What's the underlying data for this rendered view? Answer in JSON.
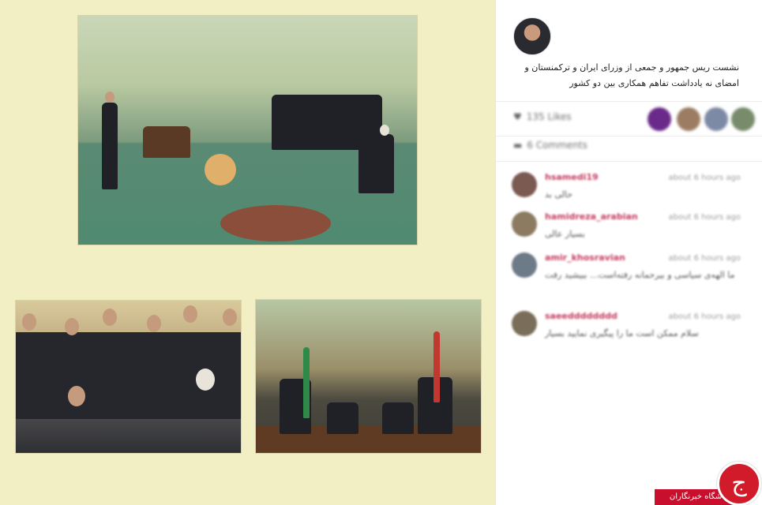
{
  "post": {
    "caption": "نشست ریس جمهور و جمعی از وزرای ایران و ترکمنستان و امضای نه یادداشت تفاهم همکاری بین دو کشور",
    "likes_label": "135 Likes",
    "comments_label": "6 Comments",
    "like_icon": "heart-icon",
    "comment_icon": "comment-icon"
  },
  "photos": [
    {
      "caption": ""
    },
    {
      "caption": ""
    },
    {
      "caption": ""
    }
  ],
  "comments": [
    {
      "user": "hsamedi19",
      "time": "about 6 hours ago",
      "text": "حالی بد"
    },
    {
      "user": "hamidreza_arabian",
      "time": "about 6 hours ago",
      "text": "بسیار عالی"
    },
    {
      "user": "amir_khosravian",
      "time": "about 6 hours ago",
      "text": "ما الهه‌ی سیاسی و بیرحمانه رفته‌است... ببیشید رفت"
    },
    {
      "user": "saeedddddddd",
      "time": "about 6 hours ago",
      "text": "سلام ممکن است ما را پیگیری نمایید بسیار"
    }
  ],
  "watermark": {
    "text": "باشگاه خبرنگاران",
    "logo_glyph": "ج"
  },
  "colors": {
    "panel_bg": "#f3efc4",
    "username": "#c43a5f",
    "brand_red": "#c8102e"
  }
}
